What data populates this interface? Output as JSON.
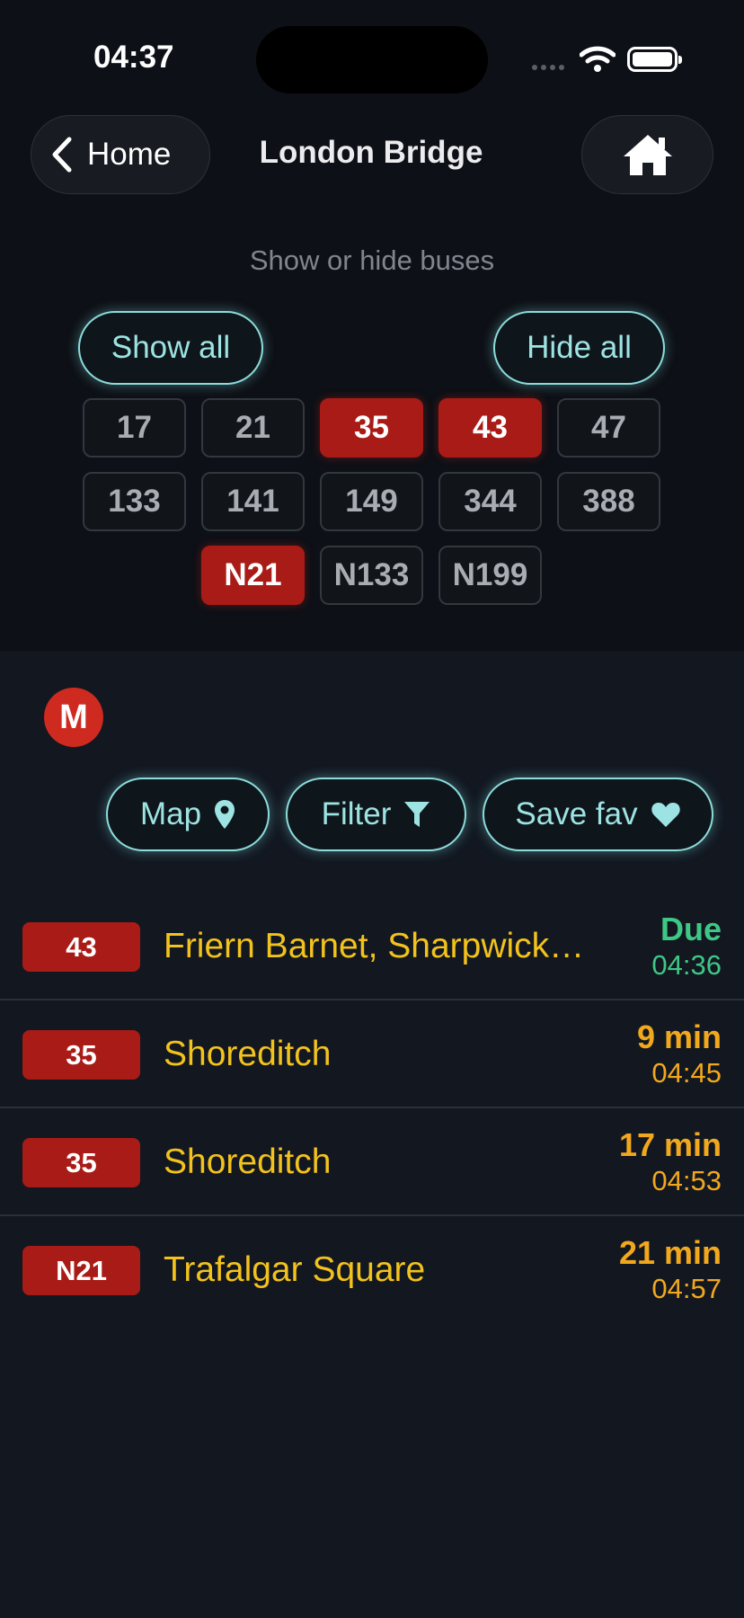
{
  "status_bar": {
    "time": "04:37"
  },
  "nav": {
    "back_label": "Home",
    "title": "London Bridge"
  },
  "filter_panel": {
    "subtitle": "Show or hide buses",
    "show_all_label": "Show all",
    "hide_all_label": "Hide all",
    "routes": [
      {
        "label": "17",
        "selected": false
      },
      {
        "label": "21",
        "selected": false
      },
      {
        "label": "35",
        "selected": true
      },
      {
        "label": "43",
        "selected": true
      },
      {
        "label": "47",
        "selected": false
      },
      {
        "label": "133",
        "selected": false
      },
      {
        "label": "141",
        "selected": false
      },
      {
        "label": "149",
        "selected": false
      },
      {
        "label": "344",
        "selected": false
      },
      {
        "label": "388",
        "selected": false
      },
      {
        "label": "N21",
        "selected": true
      },
      {
        "label": "N133",
        "selected": false
      },
      {
        "label": "N199",
        "selected": false
      }
    ]
  },
  "stop": {
    "badge": "M",
    "actions": {
      "map": "Map",
      "filter": "Filter",
      "save_fav": "Save fav"
    }
  },
  "departures": [
    {
      "route": "43",
      "destination": "Friern Barnet, Sharpwick…",
      "eta": "Due",
      "time": "04:36",
      "status": "due"
    },
    {
      "route": "35",
      "destination": "Shoreditch",
      "eta": "9 min",
      "time": "04:45",
      "status": "upcoming"
    },
    {
      "route": "35",
      "destination": "Shoreditch",
      "eta": "17 min",
      "time": "04:53",
      "status": "upcoming"
    },
    {
      "route": "N21",
      "destination": "Trafalgar Square",
      "eta": "21 min",
      "time": "04:57",
      "status": "upcoming"
    }
  ],
  "colors": {
    "accent": "#8cdcdc",
    "route_selected": "#a91b16",
    "destination": "#f2c21d",
    "due": "#3fc785",
    "upcoming": "#f2a81d"
  },
  "icons": [
    "chevron-left-icon",
    "home-icon",
    "map-pin-icon",
    "filter-funnel-icon",
    "heart-icon",
    "wifi-icon",
    "battery-icon",
    "signal-icon"
  ]
}
